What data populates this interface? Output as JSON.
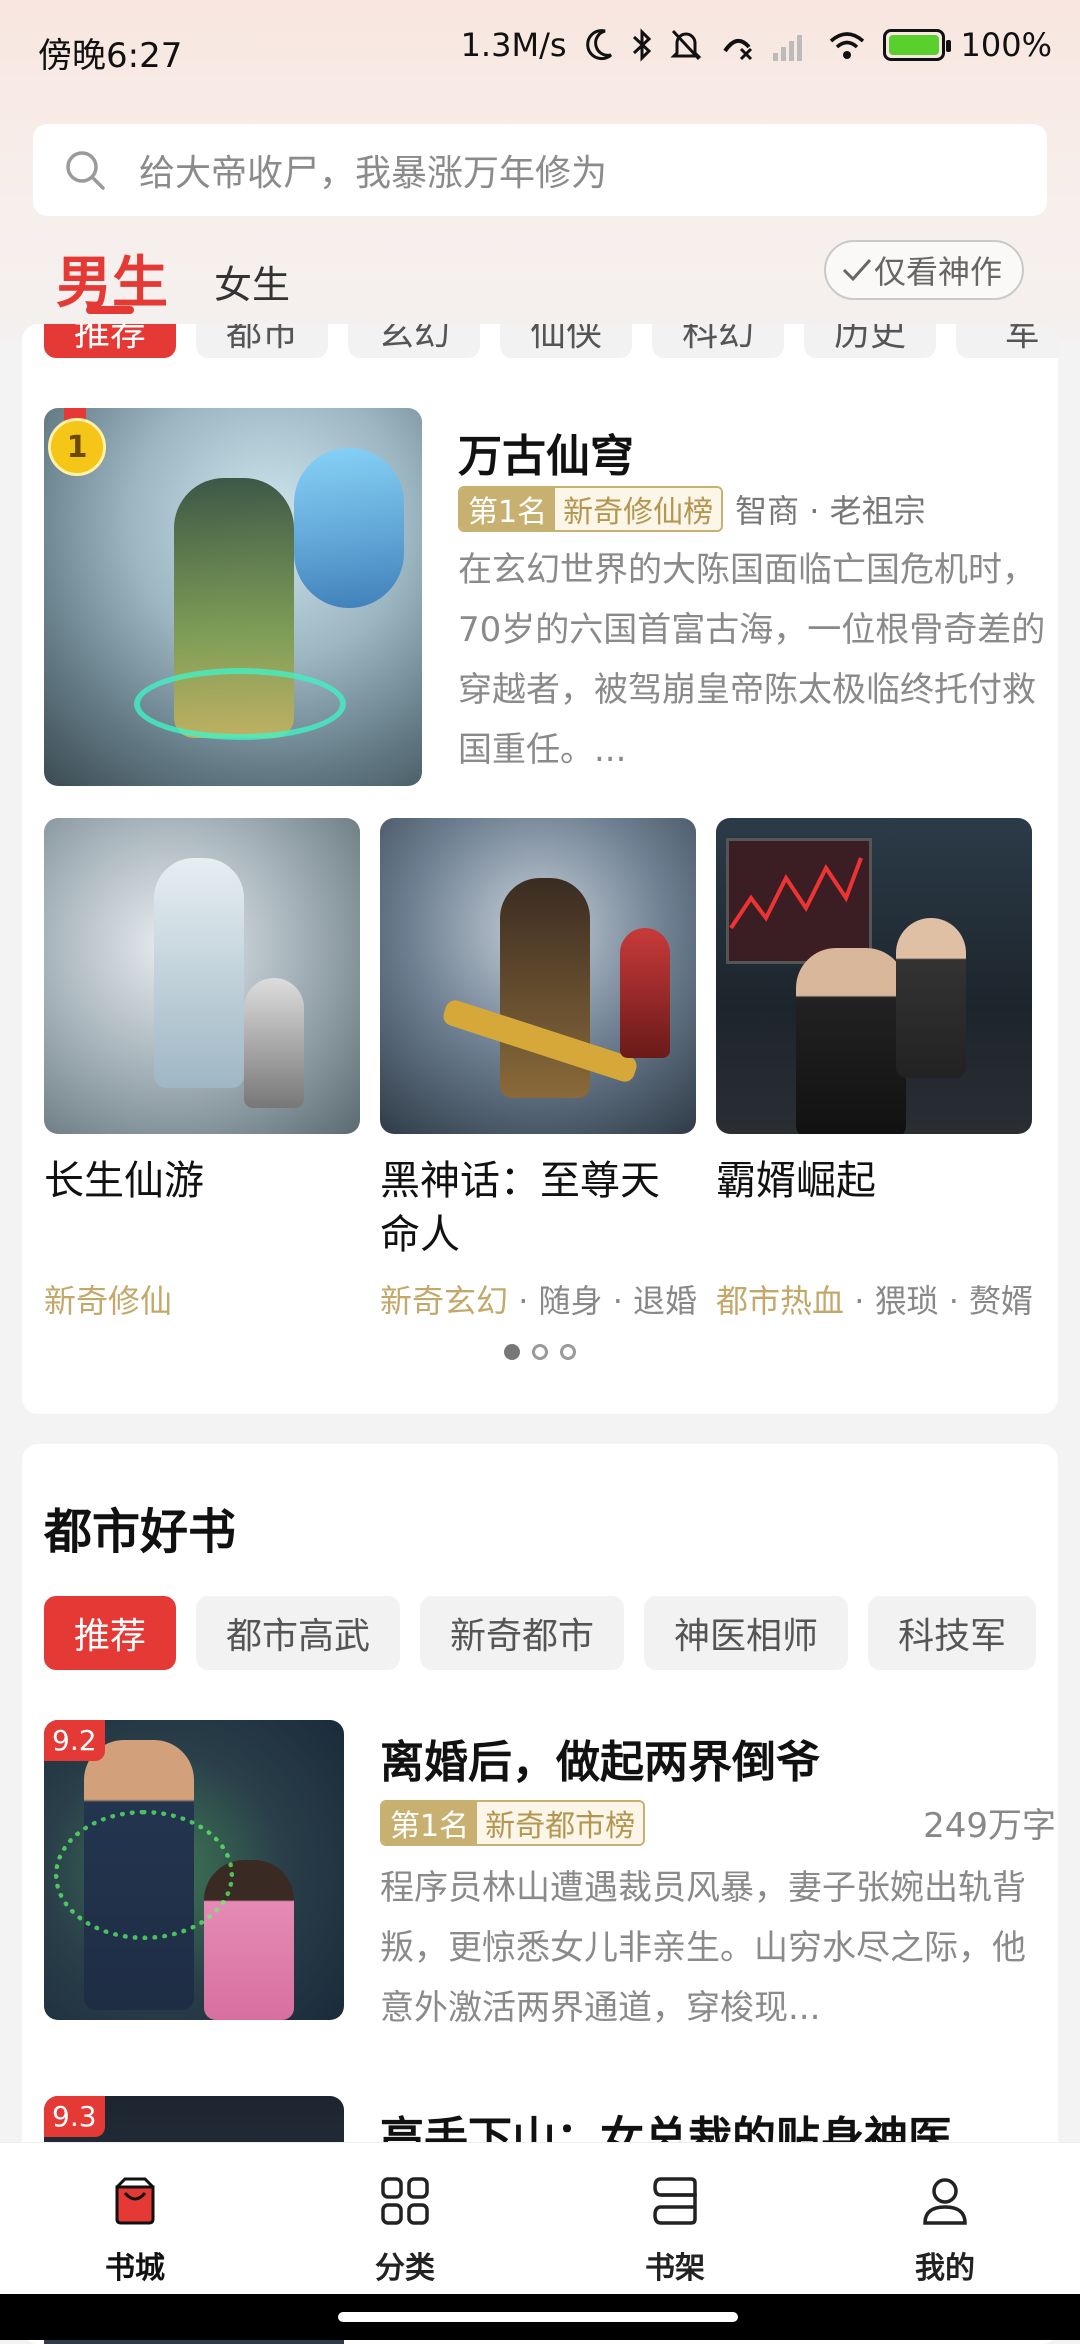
{
  "status_bar": {
    "time": "傍晚6:27",
    "speed": "1.3M/s",
    "battery": "100%"
  },
  "search": {
    "placeholder": "给大帝收尸，我暴涨万年修为"
  },
  "gender_tabs": {
    "male": "男生",
    "female": "女生"
  },
  "filter_toggle": "仅看神作",
  "genre_chips": [
    "推荐",
    "都市",
    "玄幻",
    "仙侠",
    "科幻",
    "历史",
    "军"
  ],
  "featured": {
    "rank_badge": "1",
    "title": "万古仙穹",
    "rank_label": "第1名",
    "rank_list": "新奇修仙榜",
    "tags": "智商 · 老祖宗",
    "description": "在玄幻世界的大陈国面临亡国危机时，70岁的六国首富古海，一位根骨奇差的穿越者，被驾崩皇帝陈太极临终托付救国重任。..."
  },
  "carousel_books": [
    {
      "title": "长生仙游",
      "tag_highlight": "新奇修仙",
      "tags_rest": ""
    },
    {
      "title": "黑神话：至尊天命人",
      "tag_highlight": "新奇玄幻",
      "tags_rest": " · 随身 · 退婚"
    },
    {
      "title": "霸婿崛起",
      "tag_highlight": "都市热血",
      "tags_rest": " · 猥琐 · 赘婿"
    }
  ],
  "city_section": {
    "title": "都市好书",
    "chips": [
      "推荐",
      "都市高武",
      "新奇都市",
      "神医相师",
      "科技军"
    ],
    "items": [
      {
        "score": "9.2",
        "title": "离婚后，做起两界倒爷",
        "rank_label": "第1名",
        "rank_list": "新奇都市榜",
        "words": "249万字",
        "description": "程序员林山遭遇裁员风暴，妻子张婉出轨背叛，更惊悉女儿非亲生。山穷水尽之际，他意外激活两界通道，穿梭现..."
      },
      {
        "score": "9.3",
        "title": "高手下山：女总裁的贴身神医"
      }
    ]
  },
  "bottom_nav": [
    {
      "label": "书城",
      "icon": "bookstore-icon"
    },
    {
      "label": "分类",
      "icon": "grid-icon"
    },
    {
      "label": "书架",
      "icon": "bookshelf-icon"
    },
    {
      "label": "我的",
      "icon": "profile-icon"
    }
  ],
  "colors": {
    "accent": "#e53935",
    "gold": "#c4a86a"
  }
}
